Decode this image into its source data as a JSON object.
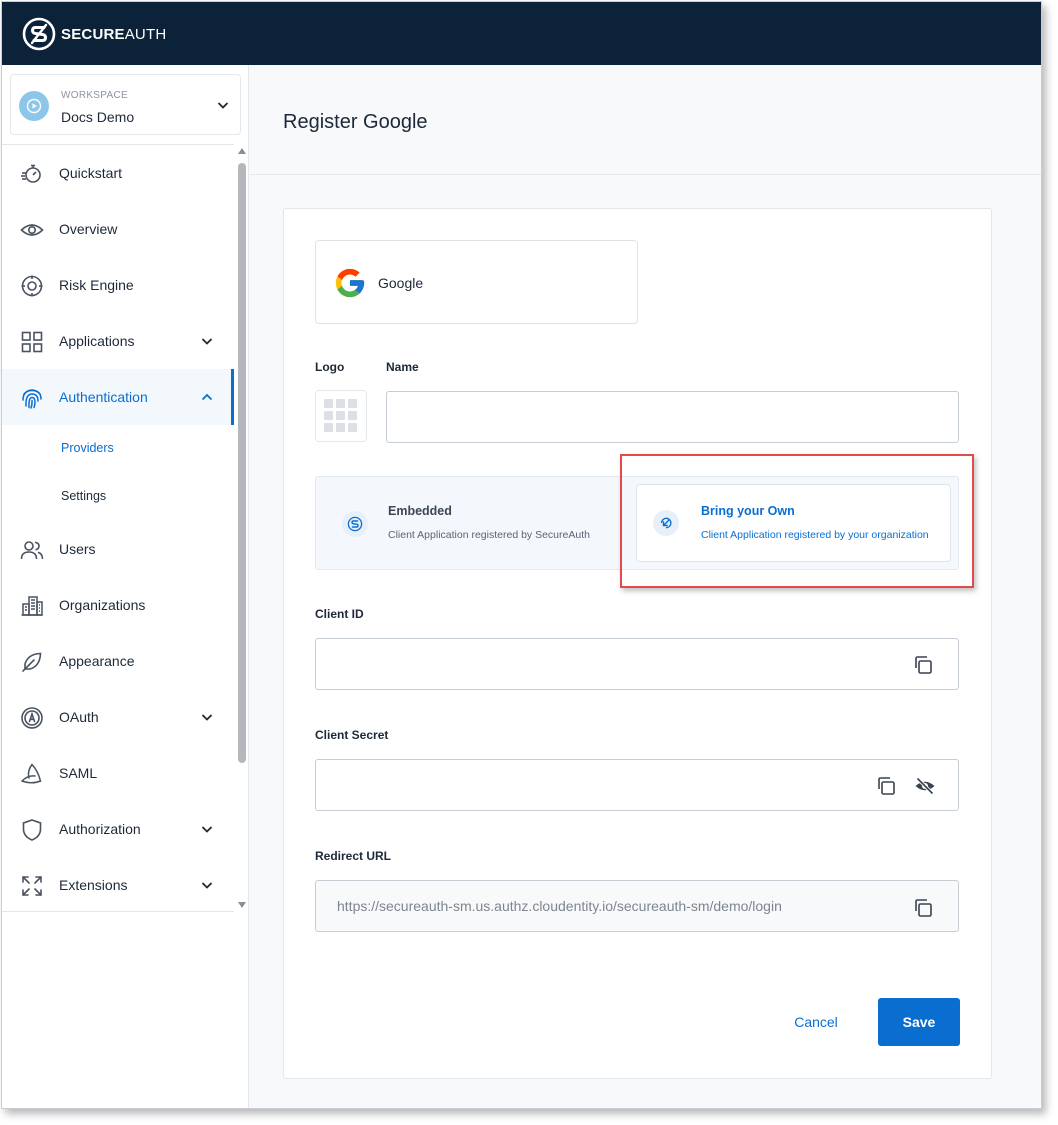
{
  "header": {
    "brand_bold": "SECURE",
    "brand_light": "AUTH",
    "logo_icon": "secureauth-logo-icon"
  },
  "workspace": {
    "label": "WORKSPACE",
    "name": "Docs Demo"
  },
  "sidebar": {
    "items": [
      {
        "label": "Quickstart",
        "icon": "stopwatch-icon"
      },
      {
        "label": "Overview",
        "icon": "eye-icon"
      },
      {
        "label": "Risk Engine",
        "icon": "target-icon"
      },
      {
        "label": "Applications",
        "icon": "grid-icon"
      },
      {
        "label": "Authentication",
        "icon": "fingerprint-icon",
        "active": true
      },
      {
        "label": "Users",
        "icon": "users-icon"
      },
      {
        "label": "Organizations",
        "icon": "buildings-icon"
      },
      {
        "label": "Appearance",
        "icon": "feather-icon"
      },
      {
        "label": "OAuth",
        "icon": "oauth-icon"
      },
      {
        "label": "SAML",
        "icon": "saml-icon"
      },
      {
        "label": "Authorization",
        "icon": "shield-icon"
      },
      {
        "label": "Extensions",
        "icon": "expand-icon"
      }
    ],
    "sub_items": [
      {
        "label": "Providers",
        "active": true
      },
      {
        "label": "Settings"
      }
    ]
  },
  "page": {
    "title": "Register Google"
  },
  "provider": {
    "name": "Google",
    "icon": "google-logo-icon"
  },
  "form": {
    "logo_label": "Logo",
    "name_label": "Name",
    "name_value": "",
    "options": [
      {
        "title": "Embedded",
        "desc": "Client Application registered by SecureAuth",
        "selected": false
      },
      {
        "title": "Bring your Own",
        "desc": "Client Application registered by your organization",
        "selected": true
      }
    ],
    "client_id_label": "Client ID",
    "client_id_value": "",
    "client_secret_label": "Client Secret",
    "client_secret_value": "",
    "redirect_label": "Redirect URL",
    "redirect_value": "https://secureauth-sm.us.authz.cloudentity.io/secureauth-sm/demo/login",
    "cancel_label": "Cancel",
    "save_label": "Save"
  },
  "colors": {
    "topbar": "#0b2239",
    "accent": "#0a6ed1",
    "highlight": "#e34a4a"
  }
}
